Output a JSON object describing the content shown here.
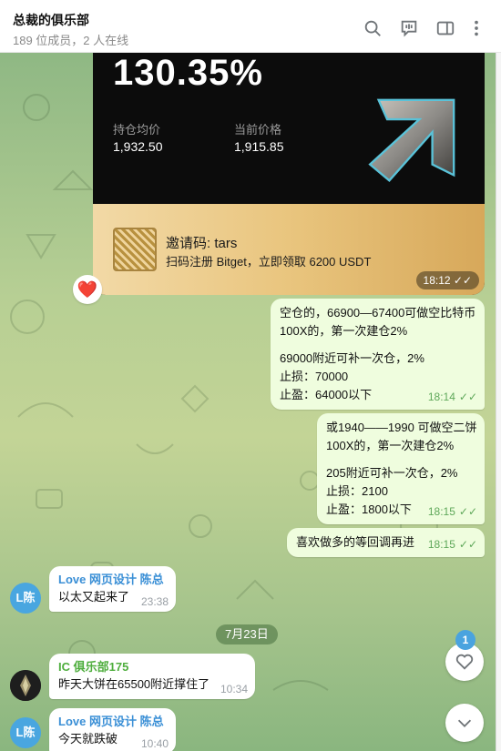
{
  "header": {
    "title": "总裁的俱乐部",
    "subtitle": "189 位成员，2 人在线",
    "icons": [
      "search-icon",
      "live-chat-icon",
      "sidebar-icon",
      "more-icon"
    ]
  },
  "card": {
    "percent": "130.35%",
    "avg_label": "持仓均价",
    "avg_value": "1,932.50",
    "price_label": "当前价格",
    "price_value": "1,915.85",
    "invite_code": "邀请码: tars",
    "invite_text": "扫码注册 Bitget，立即领取 6200 USDT",
    "time": "18:12",
    "reaction": "❤️"
  },
  "outgoing": [
    {
      "lines": [
        "空仓的，66900—67400可做空比特币",
        "100X的，第一次建仓2%",
        "",
        "69000附近可补一次仓，2%",
        "止损：70000",
        "止盈：64000以下"
      ],
      "time": "18:14"
    },
    {
      "lines": [
        "或1940——1990 可做空二饼",
        "100X的，第一次建仓2%",
        "",
        "205附近可补一次仓，2%",
        "止损：2100",
        "止盈：1800以下"
      ],
      "time": "18:15"
    },
    {
      "lines": [
        "喜欢做多的等回调再进"
      ],
      "time": "18:15"
    }
  ],
  "incoming": [
    {
      "sender": "Love 网页设计 陈总",
      "text": "以太又起来了",
      "time": "23:38",
      "avatar": "L陈",
      "sender_color": "#3a8fd6",
      "avatar_color": "#49a6e0"
    },
    {
      "sender": "IC 俱乐部175",
      "text": "昨天大饼在65500附近撑住了",
      "time": "10:34",
      "sender_color": "#4fae3e",
      "avatar_color": "#2b2b2b"
    },
    {
      "sender": "Love 网页设计 陈总",
      "text": "今天就跌破",
      "time": "10:40",
      "avatar": "L陈",
      "sender_color": "#3a8fd6",
      "avatar_color": "#49a6e0"
    }
  ],
  "date_separator": "7月23日",
  "unread_reactions": "1",
  "check_mark": "✓✓"
}
